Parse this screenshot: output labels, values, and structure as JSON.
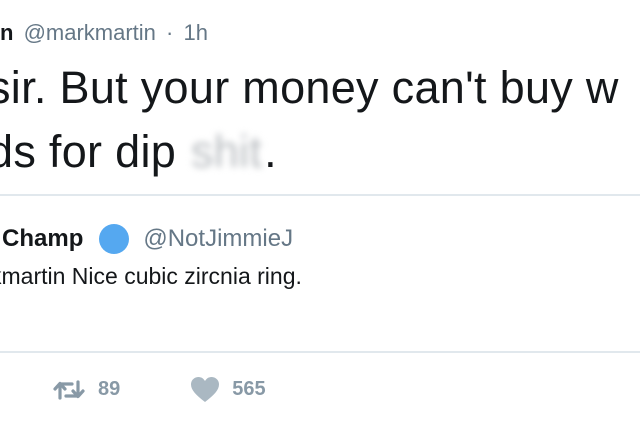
{
  "tweet": {
    "author_name": "rtin",
    "author_handle": "@markmartin",
    "separator": "·",
    "time": "1h",
    "text_line1": "sir. But your money can't buy w",
    "text_line2_prefix": "ds for dip ",
    "text_line2_blurred": "shit",
    "text_line2_suffix": "."
  },
  "quoted_tweet": {
    "author_name": "e Champ",
    "author_handle": "@NotJimmieJ",
    "text": "kmartin Nice cubic zircnia ring."
  },
  "actions": {
    "retweet_count": "89",
    "like_count": "565"
  },
  "colors": {
    "text": "#14171a",
    "muted": "#657786",
    "action": "#8899a6",
    "avatar": "#55a8f0",
    "divider": "#e1e8ed"
  }
}
